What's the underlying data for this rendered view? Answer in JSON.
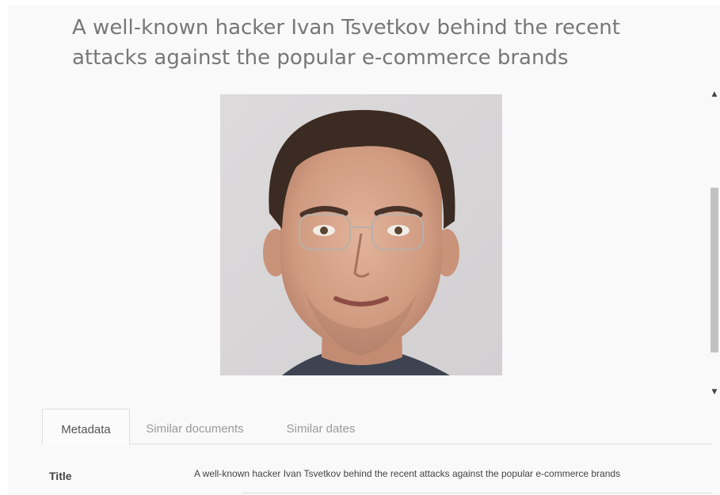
{
  "document": {
    "headline": "A well-known hacker Ivan Tsvetkov behind the recent attacks against the popular e-commerce brands"
  },
  "viewer": {
    "scroll_up_icon": "caret-up-icon",
    "scroll_down_icon": "caret-down-icon"
  },
  "tabs": [
    {
      "label": "Metadata",
      "active": true
    },
    {
      "label": "Similar documents",
      "active": false
    },
    {
      "label": "Similar dates",
      "active": false
    }
  ],
  "metadata": {
    "rows": [
      {
        "label": "Title",
        "value": "A well-known hacker Ivan Tsvetkov behind the recent attacks against the popular e-commerce brands"
      }
    ]
  }
}
